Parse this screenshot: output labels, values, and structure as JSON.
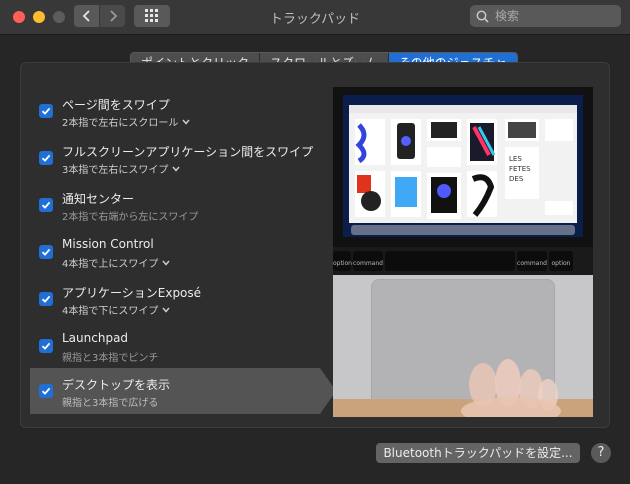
{
  "window": {
    "title": "トラックパッド"
  },
  "search": {
    "placeholder": "検索"
  },
  "tabs": [
    {
      "label": "ポイントとクリック",
      "active": false
    },
    {
      "label": "スクロールとズーム",
      "active": false
    },
    {
      "label": "その他のジェスチャ",
      "active": true
    }
  ],
  "gestures": [
    {
      "title": "ページ間をスワイプ",
      "sub": "2本指で左右にスクロール",
      "checked": true,
      "has_dropdown": true
    },
    {
      "title": "フルスクリーンアプリケーション間をスワイプ",
      "sub": "3本指で左右にスワイプ",
      "checked": true,
      "has_dropdown": true
    },
    {
      "title": "通知センター",
      "sub": "2本指で右端から左にスワイプ",
      "checked": true,
      "has_dropdown": false
    },
    {
      "title": "Mission Control",
      "sub": "4本指で上にスワイプ",
      "checked": true,
      "has_dropdown": true
    },
    {
      "title": "アプリケーションExposé",
      "sub": "4本指で下にスワイプ",
      "checked": true,
      "has_dropdown": true
    },
    {
      "title": "Launchpad",
      "sub": "親指と3本指でピンチ",
      "checked": true,
      "has_dropdown": false
    },
    {
      "title": "デスクトップを表示",
      "sub": "親指と3本指で広げる",
      "checked": true,
      "has_dropdown": false,
      "selected": true
    }
  ],
  "preview": {
    "key_left": "option",
    "key_cmd": "command",
    "key_cmd_r": "command",
    "key_right": "option"
  },
  "footer": {
    "bluetooth_button": "Bluetoothトラックパッドを設定...",
    "help": "?"
  },
  "colors": {
    "accent": "#1f6fd6",
    "background": "#262626",
    "panel": "#2e2e2e"
  }
}
